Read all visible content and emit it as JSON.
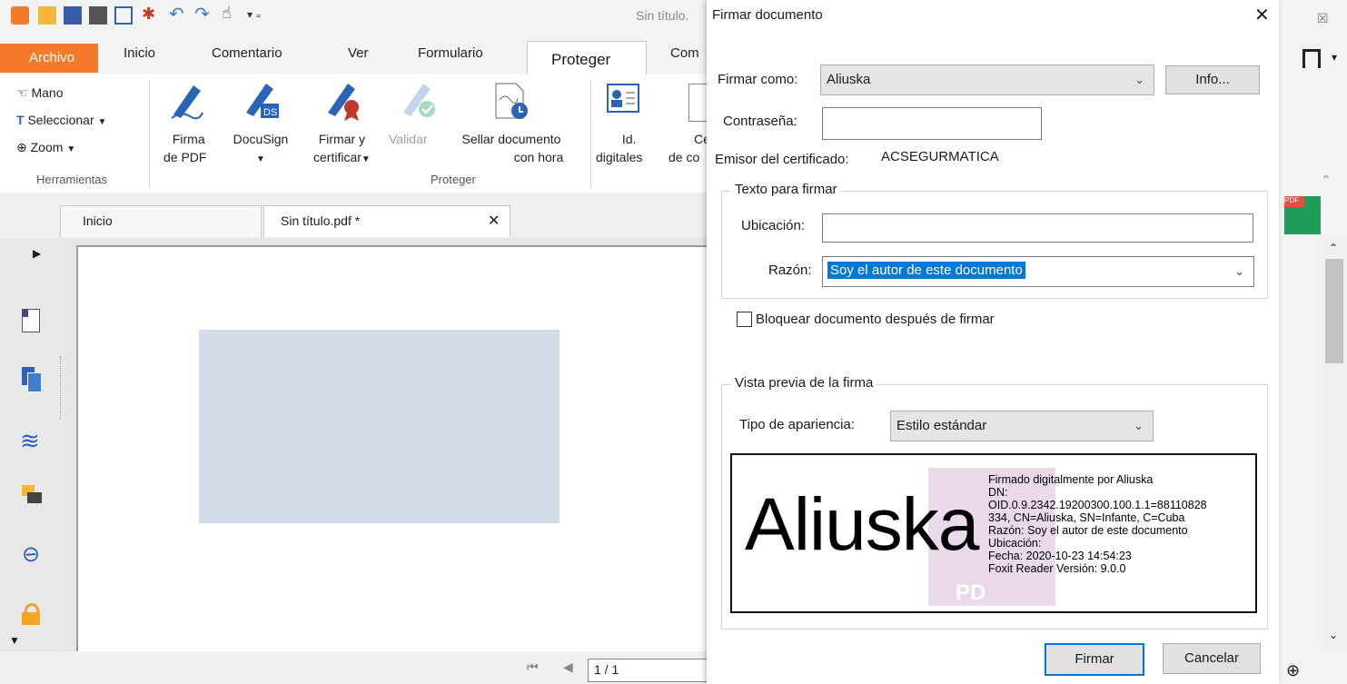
{
  "window": {
    "title": "Sin título.",
    "close_glyph": "☒"
  },
  "ribbon_tabs": [
    "Archivo",
    "Inicio",
    "Comentario",
    "Ver",
    "Formulario",
    "Proteger",
    "Com"
  ],
  "tools": {
    "mano": "Mano",
    "seleccionar": "Seleccionar",
    "zoom": "Zoom",
    "group_label": "Herramientas"
  },
  "protect": {
    "firma_l1": "Firma",
    "firma_l2": "de PDF",
    "docusign": "DocuSign",
    "firmar_l1": "Firmar y",
    "firmar_l2": "certificar",
    "validar": "Validar",
    "sellar_l1": "Sellar documento",
    "sellar_l2": "con hora",
    "id_l1": "Id.",
    "id_l2": "digitales",
    "cert_l1": "Certi",
    "cert_l2": "de co",
    "group_label": "Proteger"
  },
  "doc_tabs": {
    "inicio": "Inicio",
    "current": "Sin título.pdf *"
  },
  "nav": {
    "page": "1 / 1"
  },
  "dialog": {
    "title": "Firmar documento",
    "firmar_como_label": "Firmar como:",
    "firmar_como_value": "Aliuska",
    "info_button": "Info...",
    "password_label": "Contraseña:",
    "password_value": "",
    "emisor_label": "Emisor del certificado:",
    "emisor_value": "ACSEGURMATICA",
    "texto_group": "Texto para firmar",
    "ubicacion_label": "Ubicación:",
    "ubicacion_value": "",
    "razon_label": "Razón:",
    "razon_value": "Soy el autor de este documento",
    "bloquear_label": "Bloquear documento después de firmar",
    "bloquear_checked": false,
    "vista_group": "Vista previa de la firma",
    "tipo_label": "Tipo de apariencia:",
    "tipo_value": "Estilo estándar",
    "preview_name": "Aliuska",
    "preview_lines": [
      "Firmado digitalmente por Aliuska",
      "DN:",
      "OID.0.9.2342.19200300.100.1.1=88110828",
      "334, CN=Aliuska, SN=Infante, C=Cuba",
      "Razón: Soy el autor de este documento",
      "Ubicación:",
      "Fecha: 2020-10-23 14:54:23",
      "Foxit Reader Versión: 9.0.0"
    ],
    "firmar_button": "Firmar",
    "cancelar_button": "Cancelar"
  },
  "colors": {
    "accent_orange": "#f47b2a",
    "ribbon_blue": "#2a63b8",
    "selection": "#0078d7"
  }
}
